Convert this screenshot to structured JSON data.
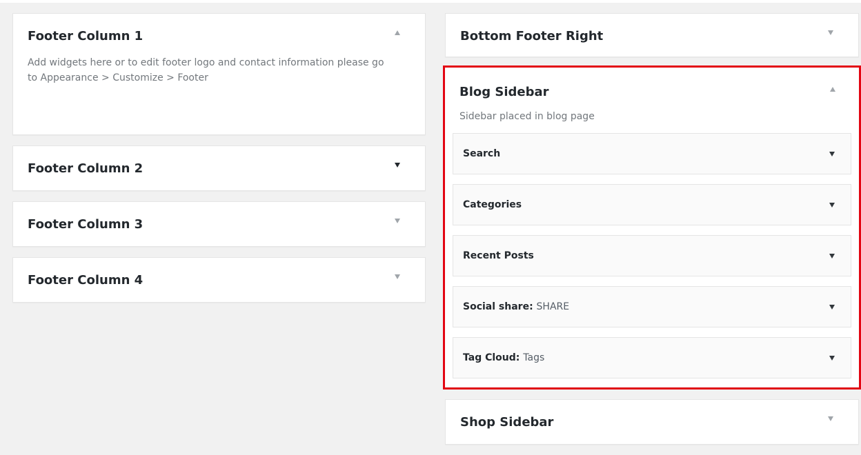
{
  "left_column": {
    "footer_column_1": {
      "title": "Footer Column 1",
      "description": "Add widgets here or to edit footer logo and contact information please go to Appearance > Customize > Footer",
      "expanded": true
    },
    "footer_column_2": {
      "title": "Footer Column 2",
      "expanded": false
    },
    "footer_column_3": {
      "title": "Footer Column 3",
      "expanded": false
    },
    "footer_column_4": {
      "title": "Footer Column 4",
      "expanded": false
    }
  },
  "right_column": {
    "bottom_footer_right": {
      "title": "Bottom Footer Right",
      "expanded": false
    },
    "blog_sidebar": {
      "title": "Blog Sidebar",
      "description": "Sidebar placed in blog page",
      "expanded": true,
      "highlight_color": "#e30613",
      "widgets": [
        {
          "title": "Search",
          "in_title": ""
        },
        {
          "title": "Categories",
          "in_title": ""
        },
        {
          "title": "Recent Posts",
          "in_title": ""
        },
        {
          "title": "Social share:",
          "in_title": "SHARE"
        },
        {
          "title": "Tag Cloud:",
          "in_title": "Tags"
        }
      ]
    },
    "shop_sidebar": {
      "title": "Shop Sidebar",
      "expanded": false
    }
  },
  "icons": {
    "collapse": "triangle-up-icon",
    "expand": "triangle-down-icon"
  }
}
